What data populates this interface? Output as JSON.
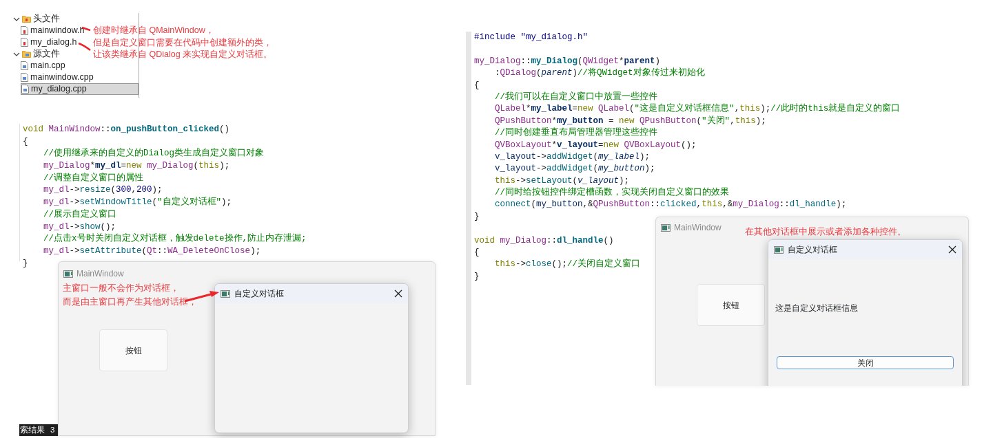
{
  "project_tree": {
    "groups": [
      {
        "label": "头文件",
        "kind": "header",
        "expanded": true,
        "children": [
          {
            "label": "mainwindow.h",
            "kind": "header",
            "selected": false
          },
          {
            "label": "my_dialog.h",
            "kind": "header",
            "selected": false
          }
        ]
      },
      {
        "label": "源文件",
        "kind": "source",
        "expanded": true,
        "children": [
          {
            "label": "main.cpp",
            "kind": "source",
            "selected": false
          },
          {
            "label": "mainwindow.cpp",
            "kind": "source",
            "selected": false
          },
          {
            "label": "my_dialog.cpp",
            "kind": "source",
            "selected": true
          }
        ]
      }
    ],
    "note": [
      "创建时继承自 QMainWindow，",
      "但是自定义窗口需要在代码中创建额外的类，",
      "让该类继承自 QDialog 来实现自定义对话框。"
    ]
  },
  "left_code": {
    "sections": [
      {
        "lines": [
          {
            "tokens": [
              {
                "text": "void ",
                "kind": "keyword"
              },
              {
                "text": "MainWindow",
                "kind": "type"
              },
              {
                "text": "::",
                "kind": "plain"
              },
              {
                "text": "on_pushButton_clicked",
                "kind": "function-bold"
              },
              {
                "text": "()",
                "kind": "plain"
              }
            ]
          },
          {
            "tokens": [
              {
                "text": "{",
                "kind": "plain"
              }
            ],
            "children": [
              {
                "tokens": [
                  {
                    "text": "//使用继承来的自定义的Dialog类生成自定义窗口对象",
                    "kind": "comment"
                  }
                ]
              },
              {
                "tokens": [
                  {
                    "text": "my_Dialog",
                    "kind": "type"
                  },
                  {
                    "text": "*",
                    "kind": "plain"
                  },
                  {
                    "text": "my_dl",
                    "kind": "declaration"
                  },
                  {
                    "text": "=",
                    "kind": "plain"
                  },
                  {
                    "text": "new ",
                    "kind": "keyword"
                  },
                  {
                    "text": "my_Dialog",
                    "kind": "type"
                  },
                  {
                    "text": "(",
                    "kind": "plain"
                  },
                  {
                    "text": "this",
                    "kind": "keyword"
                  },
                  {
                    "text": ");",
                    "kind": "plain"
                  }
                ]
              },
              {
                "tokens": [
                  {
                    "text": "//调整自定义窗口的属性",
                    "kind": "comment"
                  }
                ]
              },
              {
                "tokens": [
                  {
                    "text": "my_dl",
                    "kind": "type"
                  },
                  {
                    "text": "->",
                    "kind": "plain"
                  },
                  {
                    "text": "resize",
                    "kind": "function"
                  },
                  {
                    "text": "(",
                    "kind": "plain"
                  },
                  {
                    "text": "300",
                    "kind": "number"
                  },
                  {
                    "text": ",",
                    "kind": "plain"
                  },
                  {
                    "text": "200",
                    "kind": "number"
                  },
                  {
                    "text": ");",
                    "kind": "plain"
                  }
                ]
              },
              {
                "tokens": [
                  {
                    "text": "my_dl",
                    "kind": "type"
                  },
                  {
                    "text": "->",
                    "kind": "plain"
                  },
                  {
                    "text": "setWindowTitle",
                    "kind": "function"
                  },
                  {
                    "text": "(",
                    "kind": "plain"
                  },
                  {
                    "text": "\"自定义对话框\"",
                    "kind": "string"
                  },
                  {
                    "text": ");",
                    "kind": "plain"
                  }
                ]
              },
              {
                "tokens": [
                  {
                    "text": "//展示自定义窗口",
                    "kind": "comment"
                  }
                ]
              },
              {
                "tokens": [
                  {
                    "text": "my_dl",
                    "kind": "type"
                  },
                  {
                    "text": "->",
                    "kind": "plain"
                  },
                  {
                    "text": "show",
                    "kind": "function"
                  },
                  {
                    "text": "();",
                    "kind": "plain"
                  }
                ]
              },
              {
                "tokens": [
                  {
                    "text": "//点击x号时关闭自定义对话框，触发delete操作,防止内存泄漏;",
                    "kind": "comment"
                  }
                ]
              },
              {
                "tokens": [
                  {
                    "text": "my_dl",
                    "kind": "type"
                  },
                  {
                    "text": "->",
                    "kind": "plain"
                  },
                  {
                    "text": "setAttribute",
                    "kind": "function"
                  },
                  {
                    "text": "(",
                    "kind": "plain"
                  },
                  {
                    "text": "Qt",
                    "kind": "type"
                  },
                  {
                    "text": "::",
                    "kind": "plain"
                  },
                  {
                    "text": "WA_DeleteOnClose",
                    "kind": "type"
                  },
                  {
                    "text": ");",
                    "kind": "plain"
                  }
                ]
              }
            ]
          },
          {
            "tokens": [
              {
                "text": "}",
                "kind": "plain"
              }
            ]
          }
        ]
      }
    ]
  },
  "left_window": {
    "title": "MainWindow",
    "note": [
      "主窗口一般不会作为对话框，",
      "而是由主窗口再产生其他对话框，"
    ],
    "button": "按钮",
    "dialog": {
      "title": "自定义对话框"
    }
  },
  "search_strip": {
    "label": "索结果",
    "count": "3"
  },
  "right_code": {
    "sections": [
      {
        "lines": [
          {
            "tokens": [
              {
                "text": "#include ",
                "kind": "macro"
              },
              {
                "text": "\"my_dialog.h\"",
                "kind": "macro"
              }
            ]
          }
        ]
      },
      {
        "lines": [
          {
            "tokens": [
              {
                "text": "my_Dialog",
                "kind": "type"
              },
              {
                "text": "::",
                "kind": "plain"
              },
              {
                "text": "my_Dialog",
                "kind": "function-bold"
              },
              {
                "text": "(",
                "kind": "plain"
              },
              {
                "text": "QWidget",
                "kind": "type"
              },
              {
                "text": "*",
                "kind": "plain"
              },
              {
                "text": "parent",
                "kind": "declaration"
              },
              {
                "text": ")",
                "kind": "plain"
              }
            ],
            "children": [
              {
                "tokens": [
                  {
                    "text": ":",
                    "kind": "plain"
                  },
                  {
                    "text": "QDialog",
                    "kind": "type"
                  },
                  {
                    "text": "(",
                    "kind": "plain"
                  },
                  {
                    "text": "parent",
                    "kind": "param"
                  },
                  {
                    "text": ")",
                    "kind": "plain"
                  },
                  {
                    "text": "//将QWidget对象传过来初始化",
                    "kind": "comment"
                  }
                ]
              }
            ]
          },
          {
            "tokens": [
              {
                "text": "{",
                "kind": "plain"
              }
            ],
            "children": [
              {
                "tokens": [
                  {
                    "text": "//我们可以在自定义窗口中放置一些控件",
                    "kind": "comment"
                  }
                ]
              },
              {
                "tokens": [
                  {
                    "text": "QLabel",
                    "kind": "type"
                  },
                  {
                    "text": "*",
                    "kind": "plain"
                  },
                  {
                    "text": "my_label",
                    "kind": "declaration"
                  },
                  {
                    "text": "=",
                    "kind": "plain"
                  },
                  {
                    "text": "new ",
                    "kind": "keyword"
                  },
                  {
                    "text": "QLabel",
                    "kind": "type"
                  },
                  {
                    "text": "(",
                    "kind": "plain"
                  },
                  {
                    "text": "\"这是自定义对话框信息\"",
                    "kind": "string"
                  },
                  {
                    "text": ",",
                    "kind": "plain"
                  },
                  {
                    "text": "this",
                    "kind": "keyword"
                  },
                  {
                    "text": ");",
                    "kind": "plain"
                  },
                  {
                    "text": "//此时的this就是自定义的窗口",
                    "kind": "comment"
                  }
                ]
              },
              {
                "tokens": [
                  {
                    "text": "QPushButton",
                    "kind": "type"
                  },
                  {
                    "text": "*",
                    "kind": "plain"
                  },
                  {
                    "text": "my_button",
                    "kind": "declaration"
                  },
                  {
                    "text": " = ",
                    "kind": "plain"
                  },
                  {
                    "text": "new ",
                    "kind": "keyword"
                  },
                  {
                    "text": "QPushButton",
                    "kind": "type"
                  },
                  {
                    "text": "(",
                    "kind": "plain"
                  },
                  {
                    "text": "\"关闭\"",
                    "kind": "string"
                  },
                  {
                    "text": ",",
                    "kind": "plain"
                  },
                  {
                    "text": "this",
                    "kind": "keyword"
                  },
                  {
                    "text": ");",
                    "kind": "plain"
                  }
                ]
              },
              {
                "tokens": [
                  {
                    "text": "//同时创建垂直布局管理器管理这些控件",
                    "kind": "comment"
                  }
                ]
              },
              {
                "tokens": [
                  {
                    "text": "QVBoxLayout",
                    "kind": "type"
                  },
                  {
                    "text": "*",
                    "kind": "plain"
                  },
                  {
                    "text": "v_layout",
                    "kind": "declaration"
                  },
                  {
                    "text": "=",
                    "kind": "plain"
                  },
                  {
                    "text": "new ",
                    "kind": "keyword"
                  },
                  {
                    "text": "QVBoxLayout",
                    "kind": "type"
                  },
                  {
                    "text": "();",
                    "kind": "plain"
                  }
                ]
              },
              {
                "tokens": [
                  {
                    "text": "v_layout",
                    "kind": "variable"
                  },
                  {
                    "text": "->",
                    "kind": "plain"
                  },
                  {
                    "text": "addWidget",
                    "kind": "function"
                  },
                  {
                    "text": "(",
                    "kind": "plain"
                  },
                  {
                    "text": "my_label",
                    "kind": "param"
                  },
                  {
                    "text": ");",
                    "kind": "plain"
                  }
                ]
              },
              {
                "tokens": [
                  {
                    "text": "v_layout",
                    "kind": "variable"
                  },
                  {
                    "text": "->",
                    "kind": "plain"
                  },
                  {
                    "text": "addWidget",
                    "kind": "function"
                  },
                  {
                    "text": "(",
                    "kind": "plain"
                  },
                  {
                    "text": "my_button",
                    "kind": "param"
                  },
                  {
                    "text": ");",
                    "kind": "plain"
                  }
                ]
              },
              {
                "tokens": [
                  {
                    "text": "this",
                    "kind": "keyword"
                  },
                  {
                    "text": "->",
                    "kind": "plain"
                  },
                  {
                    "text": "setLayout",
                    "kind": "function"
                  },
                  {
                    "text": "(",
                    "kind": "plain"
                  },
                  {
                    "text": "v_layout",
                    "kind": "param"
                  },
                  {
                    "text": ");",
                    "kind": "plain"
                  }
                ]
              },
              {
                "tokens": [
                  {
                    "text": "//同时给按钮控件绑定槽函数，实现关闭自定义窗口的效果",
                    "kind": "comment"
                  }
                ]
              },
              {
                "tokens": [
                  {
                    "text": "connect",
                    "kind": "function"
                  },
                  {
                    "text": "(",
                    "kind": "plain"
                  },
                  {
                    "text": "my_button",
                    "kind": "variable"
                  },
                  {
                    "text": ",&",
                    "kind": "plain"
                  },
                  {
                    "text": "QPushButton",
                    "kind": "type"
                  },
                  {
                    "text": "::",
                    "kind": "plain"
                  },
                  {
                    "text": "clicked",
                    "kind": "function"
                  },
                  {
                    "text": ",",
                    "kind": "plain"
                  },
                  {
                    "text": "this",
                    "kind": "keyword"
                  },
                  {
                    "text": ",&",
                    "kind": "plain"
                  },
                  {
                    "text": "my_Dialog",
                    "kind": "type"
                  },
                  {
                    "text": "::",
                    "kind": "plain"
                  },
                  {
                    "text": "dl_handle",
                    "kind": "function"
                  },
                  {
                    "text": ");",
                    "kind": "plain"
                  }
                ]
              }
            ]
          },
          {
            "tokens": [
              {
                "text": "}",
                "kind": "plain"
              }
            ]
          }
        ]
      },
      {
        "lines": [
          {
            "tokens": [
              {
                "text": "void ",
                "kind": "keyword"
              },
              {
                "text": "my_Dialog",
                "kind": "type"
              },
              {
                "text": "::",
                "kind": "plain"
              },
              {
                "text": "dl_handle",
                "kind": "function-bold"
              },
              {
                "text": "()",
                "kind": "plain"
              }
            ]
          },
          {
            "tokens": [
              {
                "text": "{",
                "kind": "plain"
              }
            ],
            "children": [
              {
                "tokens": [
                  {
                    "text": "this",
                    "kind": "keyword"
                  },
                  {
                    "text": "->",
                    "kind": "plain"
                  },
                  {
                    "text": "close",
                    "kind": "function"
                  },
                  {
                    "text": "();",
                    "kind": "plain"
                  },
                  {
                    "text": "//关闭自定义窗口",
                    "kind": "comment"
                  }
                ]
              }
            ]
          },
          {
            "tokens": [
              {
                "text": "}",
                "kind": "plain"
              }
            ]
          }
        ]
      }
    ]
  },
  "right_window": {
    "title": "MainWindow",
    "note": "在其他对话框中展示或者添加各种控件。",
    "button": "按钮",
    "dialog": {
      "title": "自定义对话框",
      "label": "这是自定义对话框信息",
      "button": "关闭"
    }
  }
}
